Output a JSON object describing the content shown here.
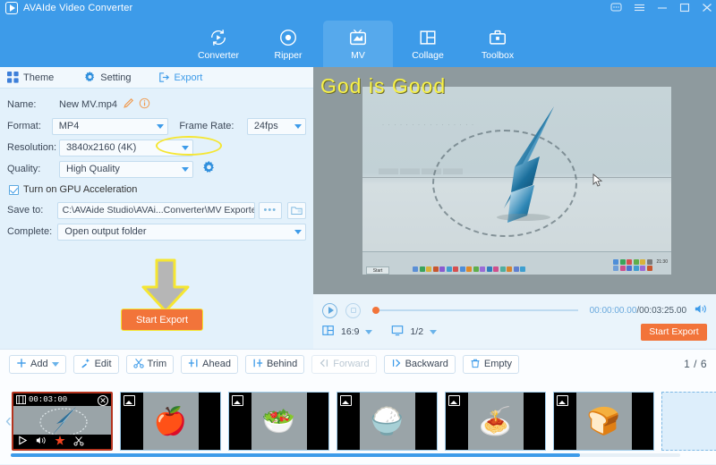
{
  "titlebar": {
    "app_name": "AVAIde Video Converter",
    "logo_icon": "play-logo-icon",
    "controls": [
      {
        "name": "feedback-icon",
        "glyph": "⬜"
      },
      {
        "name": "menu-icon",
        "glyph": "☰"
      },
      {
        "name": "minimize-icon",
        "glyph": "─"
      },
      {
        "name": "maximize-icon",
        "glyph": "□"
      },
      {
        "name": "close-icon",
        "glyph": "✕"
      }
    ]
  },
  "nav": {
    "items": [
      {
        "label": "Converter",
        "icon": "converter-icon",
        "active": false
      },
      {
        "label": "Ripper",
        "icon": "ripper-icon",
        "active": false
      },
      {
        "label": "MV",
        "icon": "mv-icon",
        "active": true
      },
      {
        "label": "Collage",
        "icon": "collage-icon",
        "active": false
      },
      {
        "label": "Toolbox",
        "icon": "toolbox-icon",
        "active": false
      }
    ]
  },
  "left_panel": {
    "tabs": [
      {
        "label": "Theme",
        "icon": "theme-grid-icon",
        "active": false
      },
      {
        "label": "Setting",
        "icon": "gear-icon",
        "active": false
      },
      {
        "label": "Export",
        "icon": "export-icon",
        "active": true,
        "highlighted": true
      }
    ],
    "fields": {
      "name_label": "Name:",
      "name_value": "New MV.mp4",
      "format_label": "Format:",
      "format_value": "MP4",
      "frame_rate_label": "Frame Rate:",
      "frame_rate_value": "24fps",
      "resolution_label": "Resolution:",
      "resolution_value": "3840x2160 (4K)",
      "quality_label": "Quality:",
      "quality_value": "High Quality",
      "gpu_label": "Turn on GPU Acceleration",
      "gpu_checked": true,
      "save_to_label": "Save to:",
      "save_to_value": "C:\\AVAide Studio\\AVAi...Converter\\MV Exported",
      "browse_label": "•••",
      "complete_label": "Complete:",
      "complete_value": "Open output folder"
    },
    "start_export_label": "Start Export",
    "arrow_icon": "down-arrow-annotation"
  },
  "preview": {
    "overlay_title": "God is Good",
    "taskbar_start": "Start",
    "taskbar_time": "21:30",
    "player": {
      "play_icon": "play-icon",
      "stop_icon": "stop-icon",
      "current_time": "00:00:00.00",
      "separator": "/",
      "total_time": "00:03:25.00",
      "volume_icon": "volume-icon",
      "aspect_icon": "aspect-ratio-icon",
      "aspect_value": "16:9",
      "zoom_icon": "screen-icon",
      "zoom_value": "1/2",
      "start_export_label": "Start Export"
    }
  },
  "toolbar": {
    "buttons": [
      {
        "label": "Add",
        "icon": "plus-icon",
        "has_caret": true,
        "disabled": false
      },
      {
        "label": "Edit",
        "icon": "magic-wand-icon",
        "has_caret": false,
        "disabled": false
      },
      {
        "label": "Trim",
        "icon": "scissors-icon",
        "has_caret": false,
        "disabled": false
      },
      {
        "label": "Ahead",
        "icon": "insert-ahead-icon",
        "has_caret": false,
        "disabled": false
      },
      {
        "label": "Behind",
        "icon": "insert-behind-icon",
        "has_caret": false,
        "disabled": false
      },
      {
        "label": "Forward",
        "icon": "move-forward-icon",
        "has_caret": false,
        "disabled": true
      },
      {
        "label": "Backward",
        "icon": "move-backward-icon",
        "has_caret": false,
        "disabled": false
      },
      {
        "label": "Empty",
        "icon": "trash-icon",
        "has_caret": false,
        "disabled": false
      }
    ],
    "page_indicator": "1 / 6"
  },
  "filmstrip": {
    "prev_icon": "chevron-left-icon",
    "next_icon": "chevron-right-icon",
    "items": [
      {
        "name": "clip-video",
        "selected": true,
        "timestamp": "00:03:00",
        "glyph": "",
        "close_icon": "close-icon",
        "controls": [
          "play-icon",
          "volume-icon",
          "effects-icon",
          "scissors-icon"
        ]
      },
      {
        "name": "clip-fruit",
        "selected": false,
        "glyph": "🍎"
      },
      {
        "name": "clip-vegetables",
        "selected": false,
        "glyph": "🥗"
      },
      {
        "name": "clip-rice-bowl",
        "selected": false,
        "glyph": "🍚"
      },
      {
        "name": "clip-spaghetti",
        "selected": false,
        "glyph": "🍝"
      },
      {
        "name": "clip-bread",
        "selected": false,
        "glyph": "🍞"
      },
      {
        "name": "clip-add-placeholder",
        "selected": false,
        "glyph": ""
      }
    ]
  },
  "colors": {
    "brand_blue": "#3d9be9",
    "accent_orange": "#f2743a",
    "highlight_yellow": "#f5e632",
    "panel_blue": "#e3f1fb",
    "overlay_yellow": "#f7f14a"
  }
}
